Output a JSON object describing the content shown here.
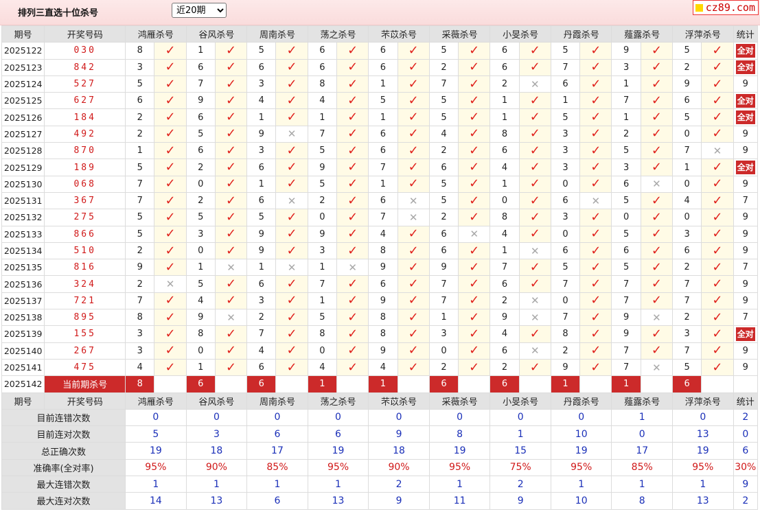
{
  "header": {
    "title": "排列三直选十位杀号",
    "period_select": {
      "selected": "近20期",
      "options": [
        "近20期"
      ]
    },
    "brand": "cz89.com"
  },
  "columns": {
    "period": "期号",
    "draw": "开奖号码",
    "experts": [
      "鸿雁杀号",
      "谷风杀号",
      "周南杀号",
      "荡之杀号",
      "芣苡杀号",
      "采薇杀号",
      "小旻杀号",
      "丹霞杀号",
      "薤露杀号",
      "浮萍杀号"
    ],
    "stat": "统计"
  },
  "rows": [
    {
      "period": "2025122",
      "draw": "030",
      "kills": [
        "8",
        "1",
        "5",
        "6",
        "6",
        "5",
        "6",
        "5",
        "9",
        "5"
      ],
      "marks": [
        1,
        1,
        1,
        1,
        1,
        1,
        1,
        1,
        1,
        1
      ],
      "stat": "全对"
    },
    {
      "period": "2025123",
      "draw": "842",
      "kills": [
        "3",
        "6",
        "6",
        "6",
        "6",
        "2",
        "6",
        "7",
        "3",
        "2"
      ],
      "marks": [
        1,
        1,
        1,
        1,
        1,
        1,
        1,
        1,
        1,
        1
      ],
      "stat": "全对"
    },
    {
      "period": "2025124",
      "draw": "527",
      "kills": [
        "5",
        "7",
        "3",
        "8",
        "1",
        "7",
        "2",
        "6",
        "1",
        "9"
      ],
      "marks": [
        1,
        1,
        1,
        1,
        1,
        1,
        0,
        1,
        1,
        1
      ],
      "stat": "9"
    },
    {
      "period": "2025125",
      "draw": "627",
      "kills": [
        "6",
        "9",
        "4",
        "4",
        "5",
        "5",
        "1",
        "1",
        "7",
        "6"
      ],
      "marks": [
        1,
        1,
        1,
        1,
        1,
        1,
        1,
        1,
        1,
        1
      ],
      "stat": "全对"
    },
    {
      "period": "2025126",
      "draw": "184",
      "kills": [
        "2",
        "6",
        "1",
        "1",
        "1",
        "5",
        "1",
        "5",
        "1",
        "5"
      ],
      "marks": [
        1,
        1,
        1,
        1,
        1,
        1,
        1,
        1,
        1,
        1
      ],
      "stat": "全对"
    },
    {
      "period": "2025127",
      "draw": "492",
      "kills": [
        "2",
        "5",
        "9",
        "7",
        "6",
        "4",
        "8",
        "3",
        "2",
        "0"
      ],
      "marks": [
        1,
        1,
        0,
        1,
        1,
        1,
        1,
        1,
        1,
        1
      ],
      "stat": "9"
    },
    {
      "period": "2025128",
      "draw": "870",
      "kills": [
        "1",
        "6",
        "3",
        "5",
        "6",
        "2",
        "6",
        "3",
        "5",
        "7"
      ],
      "marks": [
        1,
        1,
        1,
        1,
        1,
        1,
        1,
        1,
        1,
        0
      ],
      "stat": "9"
    },
    {
      "period": "2025129",
      "draw": "189",
      "kills": [
        "5",
        "2",
        "6",
        "9",
        "7",
        "6",
        "4",
        "3",
        "3",
        "1"
      ],
      "marks": [
        1,
        1,
        1,
        1,
        1,
        1,
        1,
        1,
        1,
        1
      ],
      "stat": "全对"
    },
    {
      "period": "2025130",
      "draw": "068",
      "kills": [
        "7",
        "0",
        "1",
        "5",
        "1",
        "5",
        "1",
        "0",
        "6",
        "0"
      ],
      "marks": [
        1,
        1,
        1,
        1,
        1,
        1,
        1,
        1,
        0,
        1
      ],
      "stat": "9"
    },
    {
      "period": "2025131",
      "draw": "367",
      "kills": [
        "7",
        "2",
        "6",
        "2",
        "6",
        "5",
        "0",
        "6",
        "5",
        "4"
      ],
      "marks": [
        1,
        1,
        0,
        1,
        0,
        1,
        1,
        0,
        1,
        1
      ],
      "stat": "7"
    },
    {
      "period": "2025132",
      "draw": "275",
      "kills": [
        "5",
        "5",
        "5",
        "0",
        "7",
        "2",
        "8",
        "3",
        "0",
        "0"
      ],
      "marks": [
        1,
        1,
        1,
        1,
        0,
        1,
        1,
        1,
        1,
        1
      ],
      "stat": "9"
    },
    {
      "period": "2025133",
      "draw": "866",
      "kills": [
        "5",
        "3",
        "9",
        "9",
        "4",
        "6",
        "4",
        "0",
        "5",
        "3"
      ],
      "marks": [
        1,
        1,
        1,
        1,
        1,
        0,
        1,
        1,
        1,
        1
      ],
      "stat": "9"
    },
    {
      "period": "2025134",
      "draw": "510",
      "kills": [
        "2",
        "0",
        "9",
        "3",
        "8",
        "6",
        "1",
        "6",
        "6",
        "6"
      ],
      "marks": [
        1,
        1,
        1,
        1,
        1,
        1,
        0,
        1,
        1,
        1
      ],
      "stat": "9"
    },
    {
      "period": "2025135",
      "draw": "816",
      "kills": [
        "9",
        "1",
        "1",
        "1",
        "9",
        "9",
        "7",
        "5",
        "5",
        "2"
      ],
      "marks": [
        1,
        0,
        0,
        0,
        1,
        1,
        1,
        1,
        1,
        1
      ],
      "stat": "7"
    },
    {
      "period": "2025136",
      "draw": "324",
      "kills": [
        "2",
        "5",
        "6",
        "7",
        "6",
        "7",
        "6",
        "7",
        "7",
        "7"
      ],
      "marks": [
        0,
        1,
        1,
        1,
        1,
        1,
        1,
        1,
        1,
        1
      ],
      "stat": "9"
    },
    {
      "period": "2025137",
      "draw": "721",
      "kills": [
        "7",
        "4",
        "3",
        "1",
        "9",
        "7",
        "2",
        "0",
        "7",
        "7"
      ],
      "marks": [
        1,
        1,
        1,
        1,
        1,
        1,
        0,
        1,
        1,
        1
      ],
      "stat": "9"
    },
    {
      "period": "2025138",
      "draw": "895",
      "kills": [
        "8",
        "9",
        "2",
        "5",
        "8",
        "1",
        "9",
        "7",
        "9",
        "2"
      ],
      "marks": [
        1,
        0,
        1,
        1,
        1,
        1,
        0,
        1,
        0,
        1
      ],
      "stat": "7"
    },
    {
      "period": "2025139",
      "draw": "155",
      "kills": [
        "3",
        "8",
        "7",
        "8",
        "8",
        "3",
        "4",
        "8",
        "9",
        "3"
      ],
      "marks": [
        1,
        1,
        1,
        1,
        1,
        1,
        1,
        1,
        1,
        1
      ],
      "stat": "全对"
    },
    {
      "period": "2025140",
      "draw": "267",
      "kills": [
        "3",
        "0",
        "4",
        "0",
        "9",
        "0",
        "6",
        "2",
        "7",
        "7"
      ],
      "marks": [
        1,
        1,
        1,
        1,
        1,
        1,
        0,
        1,
        1,
        1
      ],
      "stat": "9"
    },
    {
      "period": "2025141",
      "draw": "475",
      "kills": [
        "4",
        "1",
        "6",
        "4",
        "4",
        "2",
        "2",
        "9",
        "7",
        "5"
      ],
      "marks": [
        1,
        1,
        1,
        1,
        1,
        1,
        1,
        1,
        0,
        1
      ],
      "stat": "9"
    }
  ],
  "current": {
    "period": "2025142",
    "label": "当前期杀号",
    "picks": [
      "8",
      "6",
      "6",
      "1",
      "1",
      "6",
      "6",
      "1",
      "1",
      "6"
    ]
  },
  "summary": [
    {
      "label": "目前连错次数",
      "values": [
        "0",
        "0",
        "0",
        "0",
        "0",
        "0",
        "0",
        "0",
        "1",
        "0"
      ],
      "stat": "2",
      "kind": "num"
    },
    {
      "label": "目前连对次数",
      "values": [
        "5",
        "3",
        "6",
        "6",
        "9",
        "8",
        "1",
        "10",
        "0",
        "13"
      ],
      "stat": "0",
      "kind": "num"
    },
    {
      "label": "总正确次数",
      "values": [
        "19",
        "18",
        "17",
        "19",
        "18",
        "19",
        "15",
        "19",
        "17",
        "19"
      ],
      "stat": "6",
      "kind": "num"
    },
    {
      "label": "准确率(全对率)",
      "values": [
        "95%",
        "90%",
        "85%",
        "95%",
        "90%",
        "95%",
        "75%",
        "95%",
        "85%",
        "95%"
      ],
      "stat": "30%",
      "kind": "rate"
    },
    {
      "label": "最大连错次数",
      "values": [
        "1",
        "1",
        "1",
        "1",
        "2",
        "1",
        "2",
        "1",
        "1",
        "1"
      ],
      "stat": "9",
      "kind": "num"
    },
    {
      "label": "最大连对次数",
      "values": [
        "14",
        "13",
        "6",
        "13",
        "9",
        "11",
        "9",
        "10",
        "8",
        "13"
      ],
      "stat": "2",
      "kind": "num"
    }
  ],
  "icons": {
    "hit": "check-icon",
    "miss": "cross-icon"
  },
  "colors": {
    "header_bg": "#fadcdc",
    "badge_red": "#cc2a2a",
    "draw_red": "#d01818",
    "summary_blue": "#1a2fb8"
  }
}
